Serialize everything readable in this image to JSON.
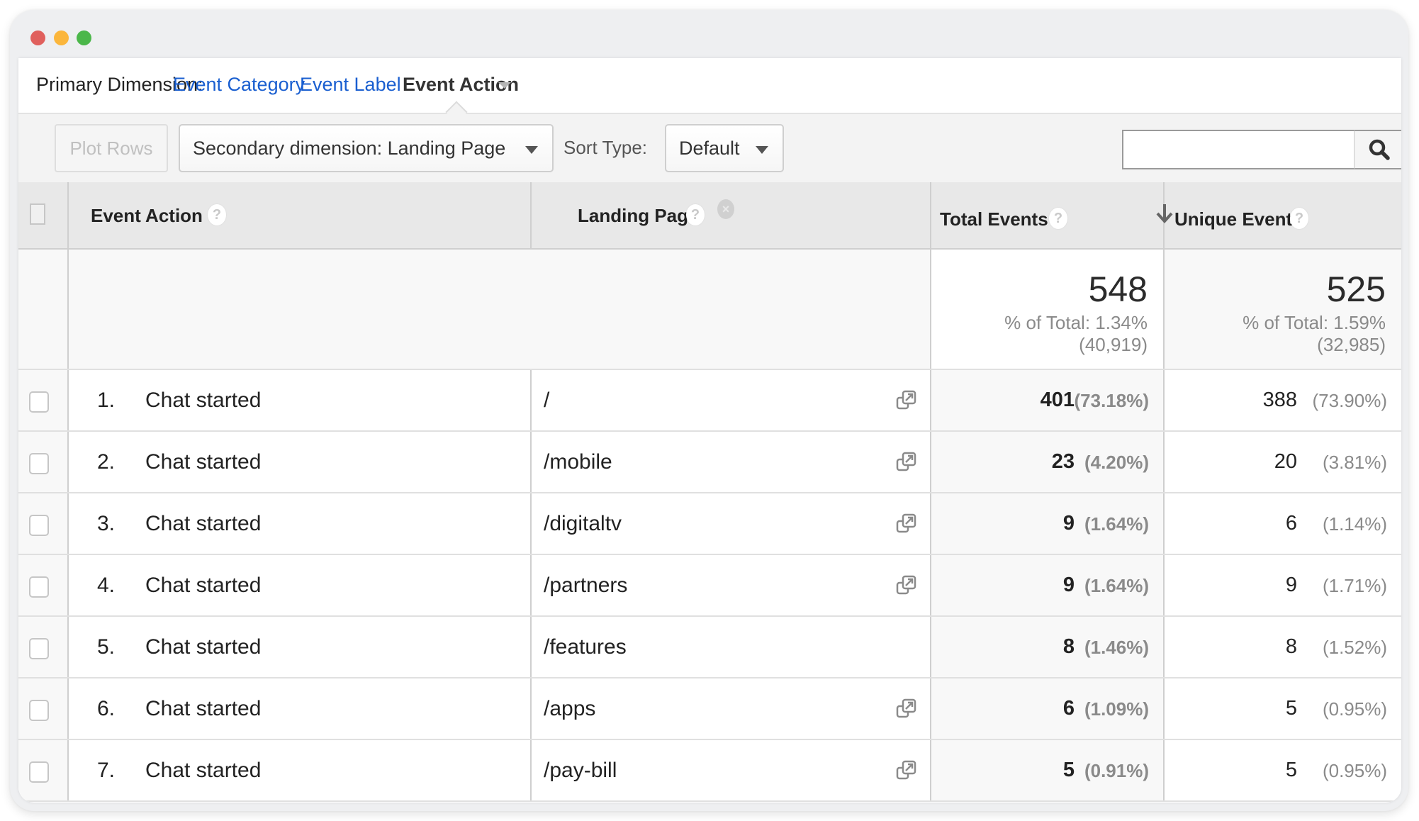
{
  "window": {
    "controls": [
      "close",
      "minimize",
      "maximize"
    ]
  },
  "primary_dimension": {
    "label": "Primary Dimension:",
    "options": [
      "Event Category",
      "Event Label"
    ],
    "selected": "Event Action"
  },
  "toolbar": {
    "plot_rows_label": "Plot Rows",
    "secondary_dimension_label": "Secondary dimension: Landing Page",
    "sort_type_label": "Sort Type:",
    "sort_type_value": "Default",
    "search_value": "",
    "search_placeholder": "",
    "search_icon": "search-icon"
  },
  "table": {
    "columns": [
      {
        "label": "Event Action",
        "help": "?"
      },
      {
        "label": "Landing Page",
        "help": "?",
        "remove": "×"
      },
      {
        "label": "Total Events",
        "help": "?",
        "sort": "descending"
      },
      {
        "label": "Unique Events",
        "help": "?"
      }
    ],
    "summary": {
      "total_events": {
        "value": "548",
        "pct_line": "% of Total: 1.34%",
        "overall": "(40,919)"
      },
      "unique_events": {
        "value": "525",
        "pct_line": "% of Total: 1.59%",
        "overall": "(32,985)"
      }
    },
    "rows": [
      {
        "num": "1.",
        "action": "Chat started",
        "page": "/",
        "has_link": true,
        "total": "401",
        "total_pct": "(73.18%)",
        "unique": "388",
        "unique_pct": "(73.90%)"
      },
      {
        "num": "2.",
        "action": "Chat started",
        "page": "/mobile",
        "has_link": true,
        "total": "23",
        "total_pct": "(4.20%)",
        "unique": "20",
        "unique_pct": "(3.81%)"
      },
      {
        "num": "3.",
        "action": "Chat started",
        "page": "/digitaltv",
        "has_link": true,
        "total": "9",
        "total_pct": "(1.64%)",
        "unique": "6",
        "unique_pct": "(1.14%)"
      },
      {
        "num": "4.",
        "action": "Chat started",
        "page": "/partners",
        "has_link": true,
        "total": "9",
        "total_pct": "(1.64%)",
        "unique": "9",
        "unique_pct": "(1.71%)"
      },
      {
        "num": "5.",
        "action": "Chat started",
        "page": "/features",
        "has_link": false,
        "total": "8",
        "total_pct": "(1.46%)",
        "unique": "8",
        "unique_pct": "(1.52%)"
      },
      {
        "num": "6.",
        "action": "Chat started",
        "page": "/apps",
        "has_link": true,
        "total": "6",
        "total_pct": "(1.09%)",
        "unique": "5",
        "unique_pct": "(0.95%)"
      },
      {
        "num": "7.",
        "action": "Chat started",
        "page": "/pay-bill",
        "has_link": true,
        "total": "5",
        "total_pct": "(0.91%)",
        "unique": "5",
        "unique_pct": "(0.95%)"
      }
    ]
  },
  "colors": {
    "link": "#1a5fd0",
    "close": "#e0605d",
    "minimize": "#fbb63c",
    "maximize": "#4bb74a"
  }
}
